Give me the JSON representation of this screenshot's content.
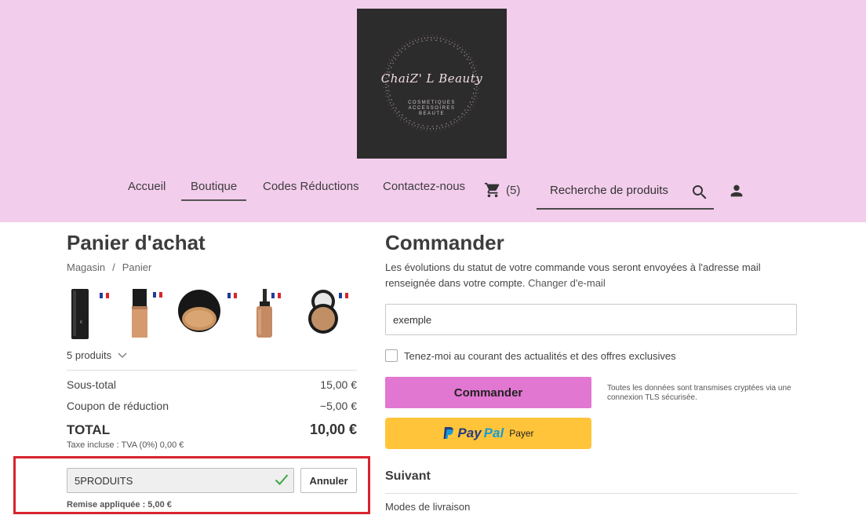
{
  "brand": {
    "name": "ChaiZ' L Beauty",
    "tagline_lines": [
      "COSMETIQUES",
      "ACCESSOIRES",
      "BEAUTE"
    ],
    "header_color": "#f3cdec"
  },
  "nav": {
    "items": [
      "Accueil",
      "Boutique",
      "Codes Réductions",
      "Contactez-nous"
    ],
    "active": "Boutique",
    "cart_count": "(5)",
    "search_placeholder": "Recherche de produits"
  },
  "cart": {
    "title": "Panier d'achat",
    "breadcrumb": [
      "Magasin",
      "/",
      "Panier"
    ],
    "products_label": "5 produits",
    "thumbnails": [
      "foundation-tube",
      "foundation-bottle",
      "powder-compact-black",
      "serum-dropper-bottle",
      "powder-compact-open"
    ],
    "subtotal_label": "Sous-total",
    "subtotal_value": "15,00 €",
    "coupon_label": "Coupon de réduction",
    "coupon_value": "−5,00 €",
    "total_label": "TOTAL",
    "total_value": "10,00 €",
    "tax_note": "Taxe incluse : TVA (0%) 0,00 €",
    "coupon_code": "5PRODUITS",
    "cancel_label": "Annuler",
    "discount_note": "Remise appliquée : 5,00 €"
  },
  "checkout": {
    "title": "Commander",
    "info_text": "Les évolutions du statut de votre commande vous seront envoyées à l'adresse mail renseignée dans votre compte.",
    "change_email_link": "Changer d'e-mail",
    "email_value": "exemple",
    "newsletter_label": "Tenez-moi au courant des actualités et des offres exclusives",
    "order_button": "Commander",
    "order_button_color": "#e277d2",
    "secure_note": "Toutes les données sont transmises cryptées via une connexion TLS sécurisée.",
    "paypal_word1": "Pay",
    "paypal_word2": "Pal",
    "paypal_suffix": "Payer",
    "paypal_color": "#ffc439",
    "next_title": "Suivant",
    "delivery_label": "Modes de livraison"
  }
}
